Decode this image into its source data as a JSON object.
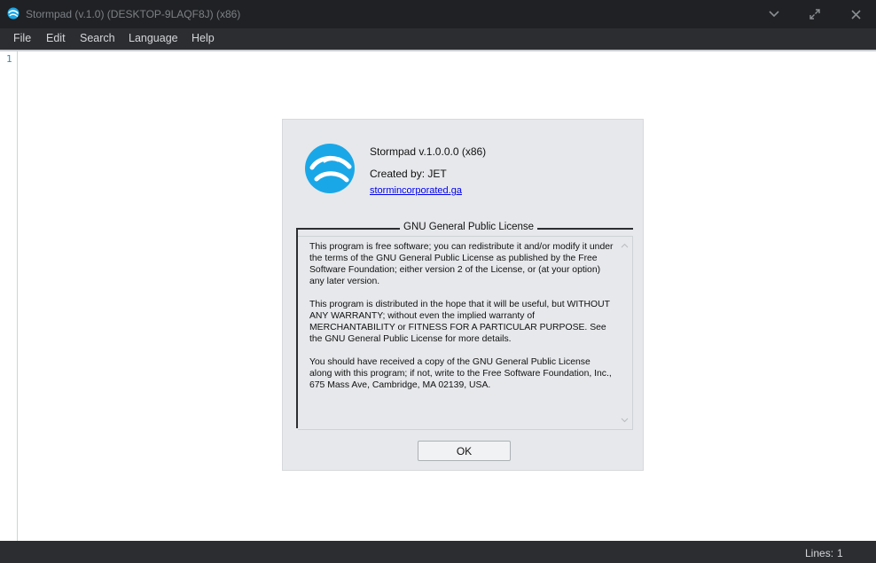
{
  "window": {
    "title": "Stormpad (v.1.0) (DESKTOP-9LAQF8J) (x86)",
    "icon": "stormpad-globe-icon",
    "buttons": {
      "minimize_icon": "chevron-down-icon",
      "maximize_icon": "expand-icon",
      "close_icon": "close-icon"
    }
  },
  "menu": {
    "items": [
      {
        "label": "File"
      },
      {
        "label": "Edit"
      },
      {
        "label": "Search"
      },
      {
        "label": "Language"
      },
      {
        "label": "Help"
      }
    ]
  },
  "editor": {
    "line_numbers": [
      "1"
    ],
    "content": ""
  },
  "about_dialog": {
    "product": "Stormpad v.1.0.0.0  (x86)",
    "created_by": "Created by: JET",
    "website": "stormincorporated.ga",
    "license_title": "GNU General Public License",
    "license_paragraphs": [
      "This program is free software; you can redistribute it and/or modify it under the terms of the GNU General Public License as published by the Free Software Foundation; either version 2 of the License, or (at your option) any later version.",
      "This program is distributed in the hope that it will be useful, but WITHOUT ANY WARRANTY; without even the implied warranty of MERCHANTABILITY or FITNESS FOR A PARTICULAR PURPOSE. See the GNU General Public License for more details.",
      "You should have received a copy of the GNU General Public License along with this program; if not, write to the Free Software Foundation, Inc., 675 Mass Ave, Cambridge, MA 02139, USA."
    ],
    "ok_label": "OK"
  },
  "statusbar": {
    "lines_label": "Lines:",
    "lines_value": "1"
  },
  "colors": {
    "titlebar_bg": "#1f2124",
    "chrome_bg": "#2b2d30",
    "dialog_bg": "#e6e8eb",
    "logo_blue": "#1aa7e8",
    "link_blue": "#0000ee",
    "line_number": "#2b91af"
  }
}
